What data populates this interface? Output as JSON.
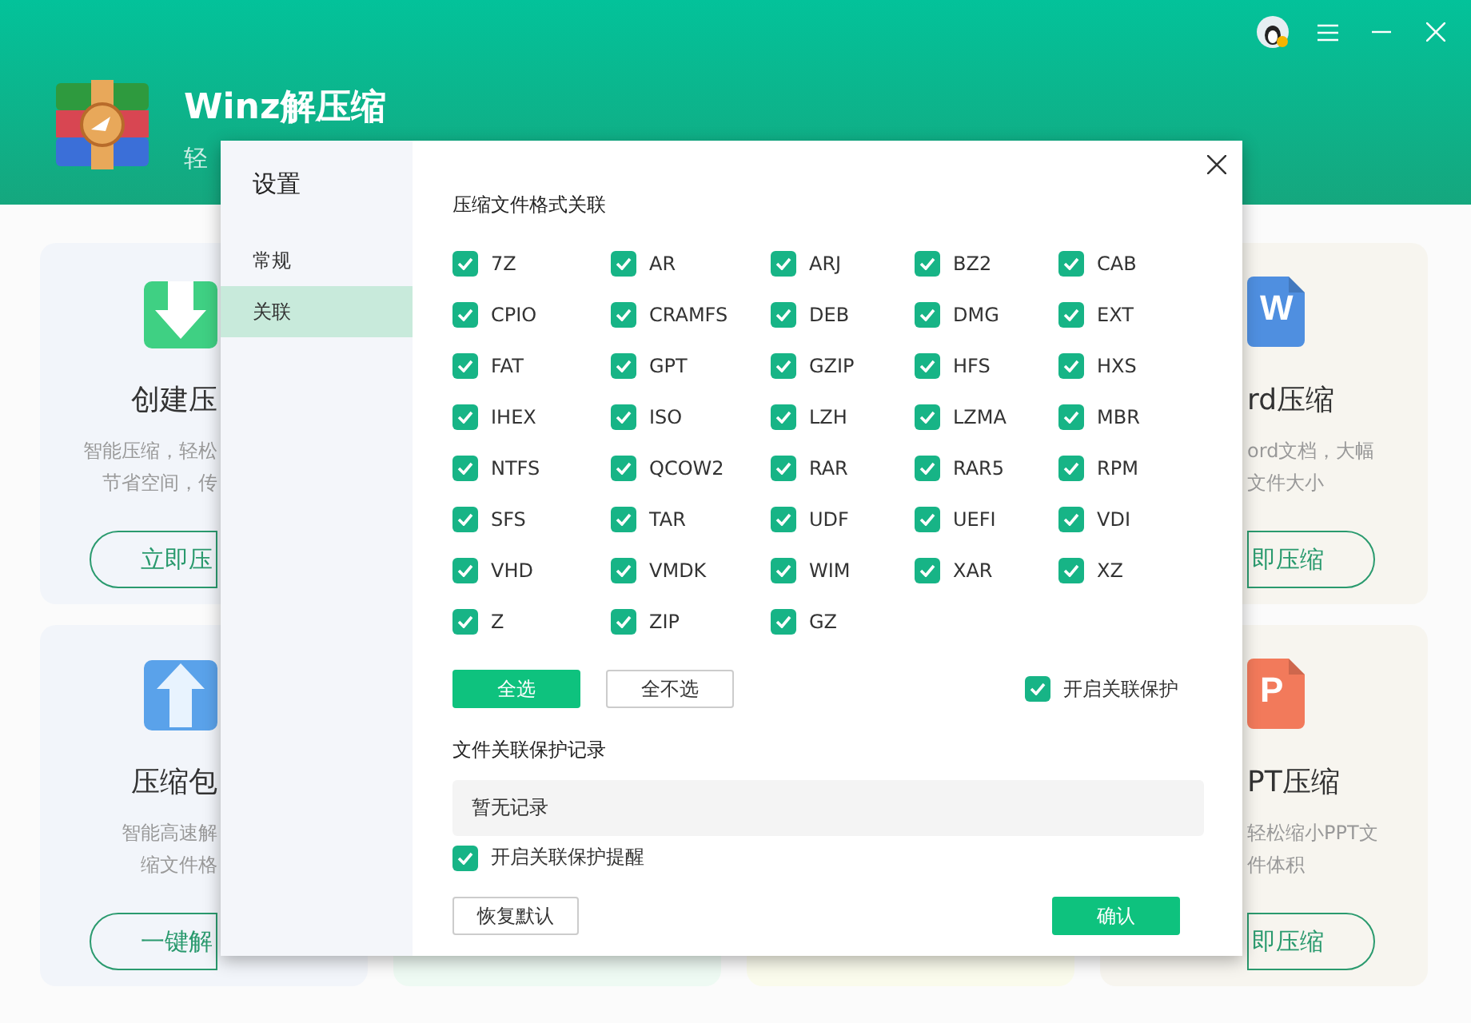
{
  "window": {
    "title": "Winz解压缩",
    "subtitle": "轻"
  },
  "cards": [
    {
      "kind": "create",
      "title": "创建压",
      "desc": [
        "智能压缩，轻松",
        "节省空间，传"
      ],
      "button": "立即压"
    },
    {
      "kind": "word",
      "icon": "W",
      "title": "rd压缩",
      "desc": [
        "ord文档，大幅",
        "文件大小"
      ],
      "button": "即压缩"
    },
    {
      "kind": "unpack",
      "title": "压缩包",
      "desc": [
        "智能高速解",
        "缩文件格"
      ],
      "button": "一键解"
    },
    {
      "kind": "ppt",
      "icon": "P",
      "title": "PT压缩",
      "desc": [
        "轻松缩小PPT文",
        "件体积"
      ],
      "button": "即压缩"
    }
  ],
  "dialog": {
    "title": "设置",
    "nav": [
      {
        "label": "常规",
        "selected": false
      },
      {
        "label": "关联",
        "selected": true
      }
    ],
    "section_title": "压缩文件格式关联",
    "formats": [
      {
        "label": "7Z",
        "checked": true
      },
      {
        "label": "AR",
        "checked": true
      },
      {
        "label": "ARJ",
        "checked": true
      },
      {
        "label": "BZ2",
        "checked": true
      },
      {
        "label": "CAB",
        "checked": true
      },
      {
        "label": "CPIO",
        "checked": true
      },
      {
        "label": "CRAMFS",
        "checked": true
      },
      {
        "label": "DEB",
        "checked": true
      },
      {
        "label": "DMG",
        "checked": true
      },
      {
        "label": "EXT",
        "checked": true
      },
      {
        "label": "FAT",
        "checked": true
      },
      {
        "label": "GPT",
        "checked": true
      },
      {
        "label": "GZIP",
        "checked": true
      },
      {
        "label": "HFS",
        "checked": true
      },
      {
        "label": "HXS",
        "checked": true
      },
      {
        "label": "IHEX",
        "checked": true
      },
      {
        "label": "ISO",
        "checked": true
      },
      {
        "label": "LZH",
        "checked": true
      },
      {
        "label": "LZMA",
        "checked": true
      },
      {
        "label": "MBR",
        "checked": true
      },
      {
        "label": "NTFS",
        "checked": true
      },
      {
        "label": "QCOW2",
        "checked": true
      },
      {
        "label": "RAR",
        "checked": true
      },
      {
        "label": "RAR5",
        "checked": true
      },
      {
        "label": "RPM",
        "checked": true
      },
      {
        "label": "SFS",
        "checked": true
      },
      {
        "label": "TAR",
        "checked": true
      },
      {
        "label": "UDF",
        "checked": true
      },
      {
        "label": "UEFI",
        "checked": true
      },
      {
        "label": "VDI",
        "checked": true
      },
      {
        "label": "VHD",
        "checked": true
      },
      {
        "label": "VMDK",
        "checked": true
      },
      {
        "label": "WIM",
        "checked": true
      },
      {
        "label": "XAR",
        "checked": true
      },
      {
        "label": "XZ",
        "checked": true
      },
      {
        "label": "Z",
        "checked": true
      },
      {
        "label": "ZIP",
        "checked": true
      },
      {
        "label": "GZ",
        "checked": true
      }
    ],
    "select_all": "全选",
    "select_none": "全不选",
    "protection": {
      "label": "开启关联保护",
      "checked": true
    },
    "record_title": "文件关联保护记录",
    "record_value": "暂无记录",
    "reminder": {
      "label": "开启关联保护提醒",
      "checked": true
    },
    "reset": "恢复默认",
    "confirm": "确认"
  }
}
